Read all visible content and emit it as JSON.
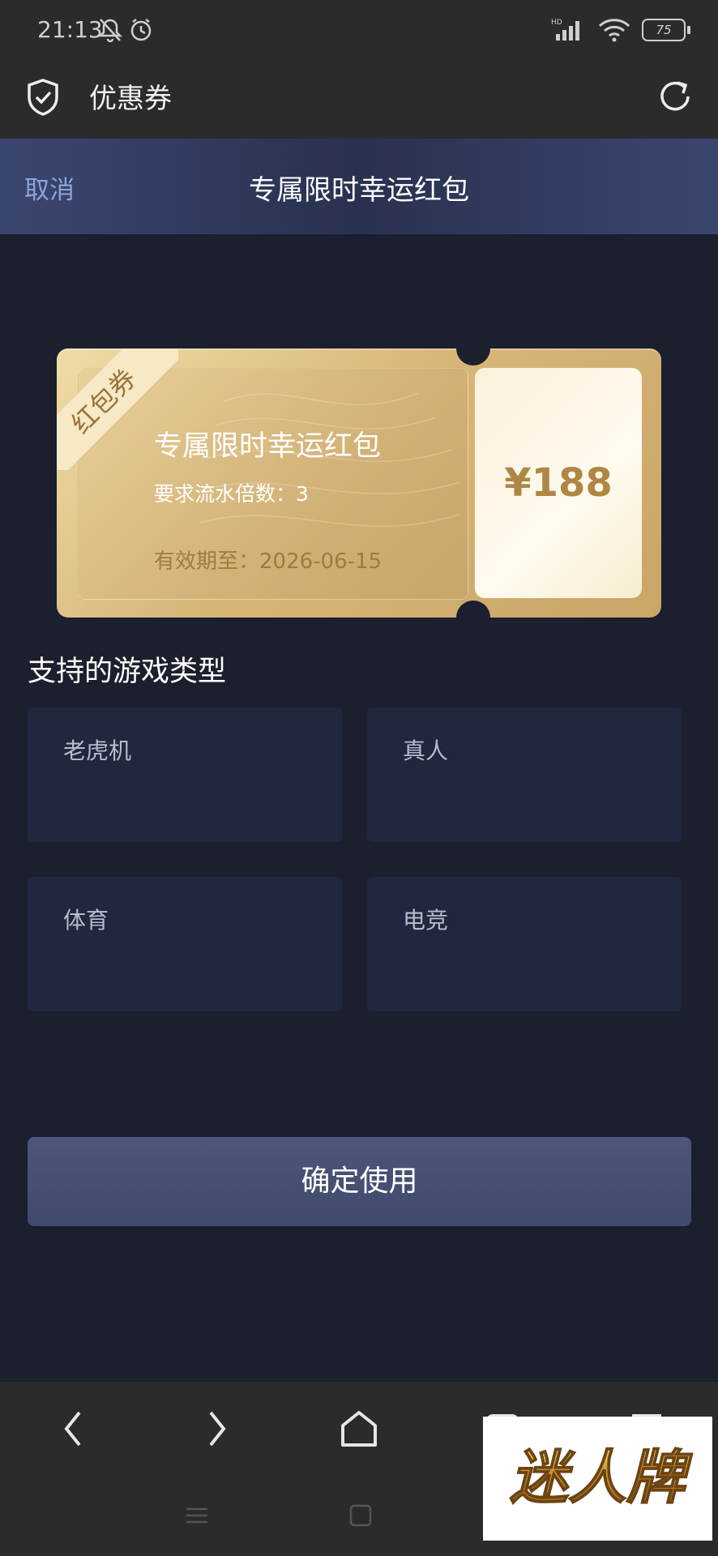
{
  "status_bar": {
    "time": "21:13",
    "battery": "75",
    "icons": [
      "bell-muted-icon",
      "alarm-icon",
      "hd-signal-icon",
      "wifi-icon",
      "battery-icon"
    ]
  },
  "browser": {
    "title": "优惠券",
    "icons": [
      "shield-check-icon",
      "refresh-icon"
    ]
  },
  "header": {
    "cancel_label": "取消",
    "title": "专属限时幸运红包"
  },
  "coupon": {
    "ribbon": "红包券",
    "name": "专属限时幸运红包",
    "requirement": "要求流水倍数：3",
    "expiry": "有效期至：2026-06-15",
    "amount": "¥188"
  },
  "games": {
    "title": "支持的游戏类型",
    "items": [
      "老虎机",
      "真人",
      "体育",
      "电竞"
    ]
  },
  "confirm_label": "确定使用",
  "bottom_nav": {
    "icons": [
      "back-icon",
      "forward-icon",
      "home-icon",
      "tabs-icon",
      "menu-icon"
    ]
  },
  "watermark": "迷人牌",
  "colors": {
    "background": "#1b1f2e",
    "header": "#3b4670",
    "gold": "#d7b778",
    "card": "#222740",
    "button": "#4d5678"
  }
}
